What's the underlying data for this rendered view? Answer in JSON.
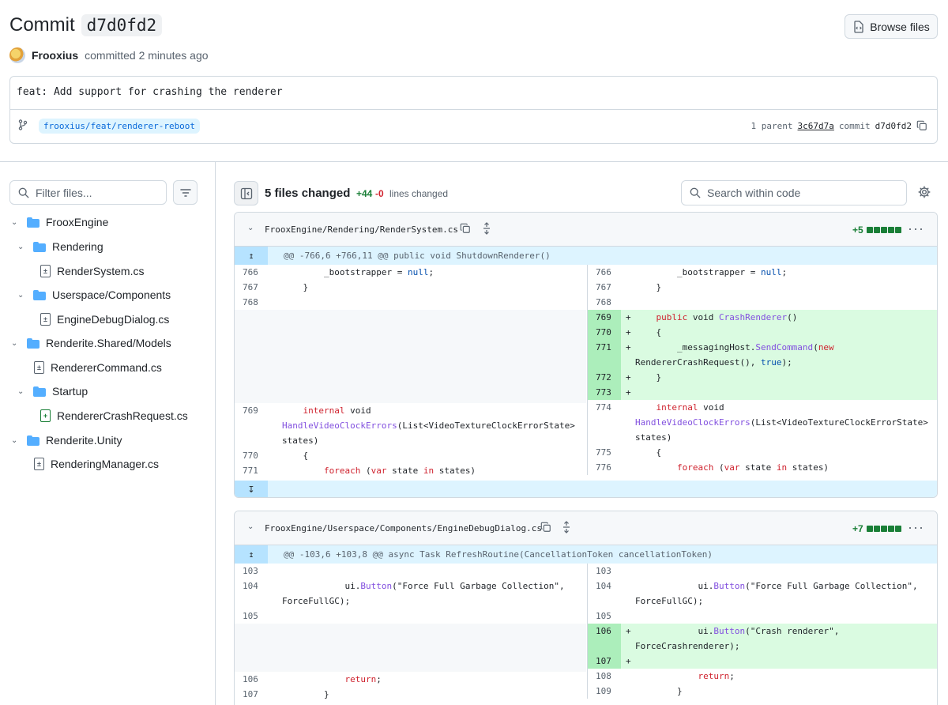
{
  "header": {
    "title_prefix": "Commit",
    "title_sha": "d7d0fd2",
    "browse_label": "Browse files",
    "author": "Frooxius",
    "committed_text": "committed 2 minutes ago",
    "message": "feat: Add support for crashing the renderer",
    "branch": "frooxius/feat/renderer-reboot",
    "parent_count_text": "1 parent",
    "parent_sha": "3c67d7a",
    "commit_label": "commit",
    "commit_sha": "d7d0fd2"
  },
  "sidebar": {
    "filter_placeholder": "Filter files...",
    "tree": [
      {
        "type": "folder",
        "label": "FrooxEngine",
        "depth": 0
      },
      {
        "type": "folder",
        "label": "Rendering",
        "depth": 1
      },
      {
        "type": "file",
        "label": "RenderSystem.cs",
        "depth": 2,
        "status": "modified"
      },
      {
        "type": "folder",
        "label": "Userspace/Components",
        "depth": 1
      },
      {
        "type": "file",
        "label": "EngineDebugDialog.cs",
        "depth": 2,
        "status": "modified"
      },
      {
        "type": "folder",
        "label": "Renderite.Shared/Models",
        "depth": 0
      },
      {
        "type": "file",
        "label": "RendererCommand.cs",
        "depth": 1,
        "status": "modified"
      },
      {
        "type": "folder",
        "label": "Startup",
        "depth": 1
      },
      {
        "type": "file",
        "label": "RendererCrashRequest.cs",
        "depth": 2,
        "status": "added"
      },
      {
        "type": "folder",
        "label": "Renderite.Unity",
        "depth": 0
      },
      {
        "type": "file",
        "label": "RenderingManager.cs",
        "depth": 1,
        "status": "modified"
      }
    ]
  },
  "toolbar": {
    "files_changed": "5 files changed",
    "additions": "+44",
    "deletions": "-0",
    "lines_changed": "lines changed",
    "search_placeholder": "Search within code"
  },
  "diffs": [
    {
      "path": "FrooxEngine/Rendering/RenderSystem.cs",
      "stat": "+5",
      "hunk": "@@ -766,6 +766,11 @@ public void ShutdownRenderer()"
    },
    {
      "path": "FrooxEngine/Userspace/Components/EngineDebugDialog.cs",
      "stat": "+7",
      "hunk": "@@ -103,6 +103,8 @@ async Task RefreshRoutine(CancellationToken cancellationToken)"
    }
  ],
  "colors": {
    "accent": "#0969da",
    "added": "#1a7f37",
    "deleted": "#d1242f",
    "add_bg": "#dafbe1",
    "hunk_bg": "#ddf4ff"
  }
}
